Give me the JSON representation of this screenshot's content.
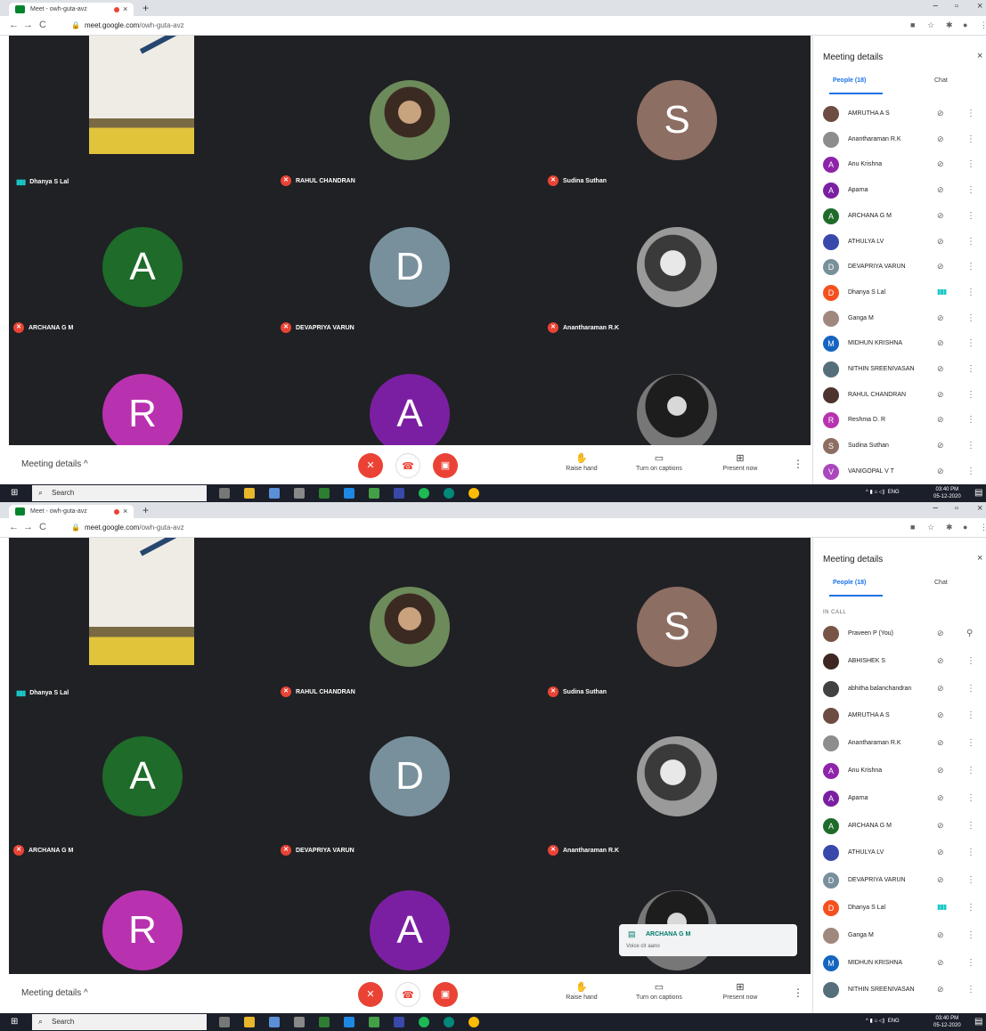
{
  "browser": {
    "tab_title": "Meet - owh-guta-avz",
    "tab_close": "×",
    "new_tab": "+",
    "url_host": "meet.google.com",
    "url_path": "/owh-guta-avz",
    "win_min": "−",
    "win_max": "▫",
    "win_close": "×",
    "back": "←",
    "forward": "→",
    "reload": "C"
  },
  "stage": {
    "tiles": [
      {
        "name": "Dhanya S Lal",
        "kind": "video",
        "speaking": true
      },
      {
        "name": "RAHUL CHANDRAN",
        "kind": "photo",
        "muted": true
      },
      {
        "name": "Sudina Suthan",
        "kind": "initial",
        "initial": "S",
        "color": "#8d6e63",
        "muted": true
      },
      {
        "name": "ARCHANA G M",
        "kind": "initial",
        "initial": "A",
        "color": "#1e6b2a",
        "muted": true
      },
      {
        "name": "DEVAPRIYA VARUN",
        "kind": "initial",
        "initial": "D",
        "color": "#78909c",
        "muted": true
      },
      {
        "name": "Anantharaman R.K",
        "kind": "photo",
        "muted": true
      },
      {
        "name": "",
        "kind": "initial",
        "initial": "R",
        "color": "#b832b0"
      },
      {
        "name": "",
        "kind": "initial",
        "initial": "A",
        "color": "#7b1fa2"
      },
      {
        "name": "",
        "kind": "photo"
      }
    ]
  },
  "controls": {
    "meeting_details": "Meeting details ^",
    "raise_hand": "Raise hand",
    "captions": "Turn on captions",
    "present": "Present now"
  },
  "panel": {
    "title": "Meeting details",
    "close": "×",
    "people_tab": "People (18)",
    "chat_tab": "Chat",
    "in_call": "IN CALL",
    "list1": [
      {
        "name": "AMRUTHA A S",
        "initial": "",
        "color": "#6d4c41"
      },
      {
        "name": "Anantharaman R.K",
        "initial": "",
        "color": "#8d8d8d"
      },
      {
        "name": "Anu Krishna",
        "initial": "A",
        "color": "#8e24aa"
      },
      {
        "name": "Aparna",
        "initial": "A",
        "color": "#7b1fa2"
      },
      {
        "name": "ARCHANA G M",
        "initial": "A",
        "color": "#1e6b2a"
      },
      {
        "name": "ATHULYA LV",
        "initial": "",
        "color": "#3949ab"
      },
      {
        "name": "DEVAPRIYA VARUN",
        "initial": "D",
        "color": "#78909c"
      },
      {
        "name": "Dhanya S Lal",
        "initial": "D",
        "color": "#f4511e",
        "speaking": true
      },
      {
        "name": "Ganga M",
        "initial": "",
        "color": "#a1887f"
      },
      {
        "name": "MIDHUN KRISHNA",
        "initial": "M",
        "color": "#1565c0"
      },
      {
        "name": "NITHIN SREENIVASAN",
        "initial": "",
        "color": "#546e7a"
      },
      {
        "name": "RAHUL CHANDRAN",
        "initial": "",
        "color": "#4e342e"
      },
      {
        "name": "Reshma D. R",
        "initial": "R",
        "color": "#b832b0"
      },
      {
        "name": "Sudina Suthan",
        "initial": "S",
        "color": "#8d6e63"
      },
      {
        "name": "VANIGOPAL V T",
        "initial": "V",
        "color": "#ab47bc"
      }
    ],
    "list2": [
      {
        "name": "Praveen P (You)",
        "initial": "",
        "color": "#795548",
        "you": true
      },
      {
        "name": "ABHISHEK S",
        "initial": "",
        "color": "#3e2723"
      },
      {
        "name": "abhitha balanchandran",
        "initial": "",
        "color": "#424242"
      },
      {
        "name": "AMRUTHA A S",
        "initial": "",
        "color": "#6d4c41"
      },
      {
        "name": "Anantharaman R.K",
        "initial": "",
        "color": "#8d8d8d"
      },
      {
        "name": "Anu Krishna",
        "initial": "A",
        "color": "#8e24aa"
      },
      {
        "name": "Aparna",
        "initial": "A",
        "color": "#7b1fa2"
      },
      {
        "name": "ARCHANA G M",
        "initial": "A",
        "color": "#1e6b2a"
      },
      {
        "name": "ATHULYA LV",
        "initial": "",
        "color": "#3949ab"
      },
      {
        "name": "DEVAPRIYA VARUN",
        "initial": "D",
        "color": "#78909c"
      },
      {
        "name": "Dhanya S Lal",
        "initial": "D",
        "color": "#f4511e",
        "speaking": true
      },
      {
        "name": "Ganga M",
        "initial": "",
        "color": "#a1887f"
      },
      {
        "name": "MIDHUN KRISHNA",
        "initial": "M",
        "color": "#1565c0"
      },
      {
        "name": "NITHIN SREENIVASAN",
        "initial": "",
        "color": "#546e7a"
      }
    ]
  },
  "toast": {
    "sender": "ARCHANA G M",
    "message": "Voice clr aano"
  },
  "taskbar": {
    "search": "Search",
    "lang": "ENG",
    "time": "03:40 PM",
    "date": "05-12-2020"
  }
}
